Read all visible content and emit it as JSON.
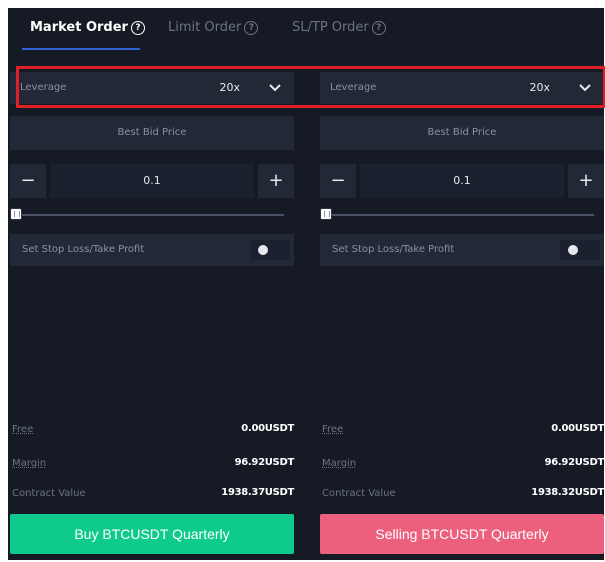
{
  "tabs": [
    {
      "label": "Market Order",
      "active": true
    },
    {
      "label": "Limit Order",
      "active": false
    },
    {
      "label": "SL/TP Order",
      "active": false
    }
  ],
  "help_glyph": "?",
  "left": {
    "leverage_label": "Leverage",
    "leverage_value": "20x",
    "best_bid_label": "Best Bid Price",
    "minus_glyph": "−",
    "plus_glyph": "+",
    "quantity": "0.1",
    "slider_level": 0,
    "stop_loss_label": "Set Stop Loss/Take Profit",
    "stop_loss_enabled": false,
    "free_label": "Free",
    "free_value": "0.00USDT",
    "margin_label": "Margin",
    "margin_value": "96.92USDT",
    "contract_label": "Contract Value",
    "contract_value": "1938.37USDT",
    "action_label": "Buy BTCUSDT Quarterly"
  },
  "right": {
    "leverage_label": "Leverage",
    "leverage_value": "20x",
    "best_bid_label": "Best Bid Price",
    "minus_glyph": "−",
    "plus_glyph": "+",
    "quantity": "0.1",
    "slider_level": 0,
    "stop_loss_label": "Set Stop Loss/Take Profit",
    "stop_loss_enabled": false,
    "free_label": "Free",
    "free_value": "0.00USDT",
    "margin_label": "Margin",
    "margin_value": "96.92USDT",
    "contract_label": "Contract Value",
    "contract_value": "1938.32USDT",
    "action_label": "Selling BTCUSDT Quarterly"
  },
  "colors": {
    "background": "#161a24",
    "buy": "#0ecb8d",
    "sell": "#ec5f7d",
    "active_tab_underline": "#2f63d6",
    "highlight_box": "#e01f26"
  }
}
